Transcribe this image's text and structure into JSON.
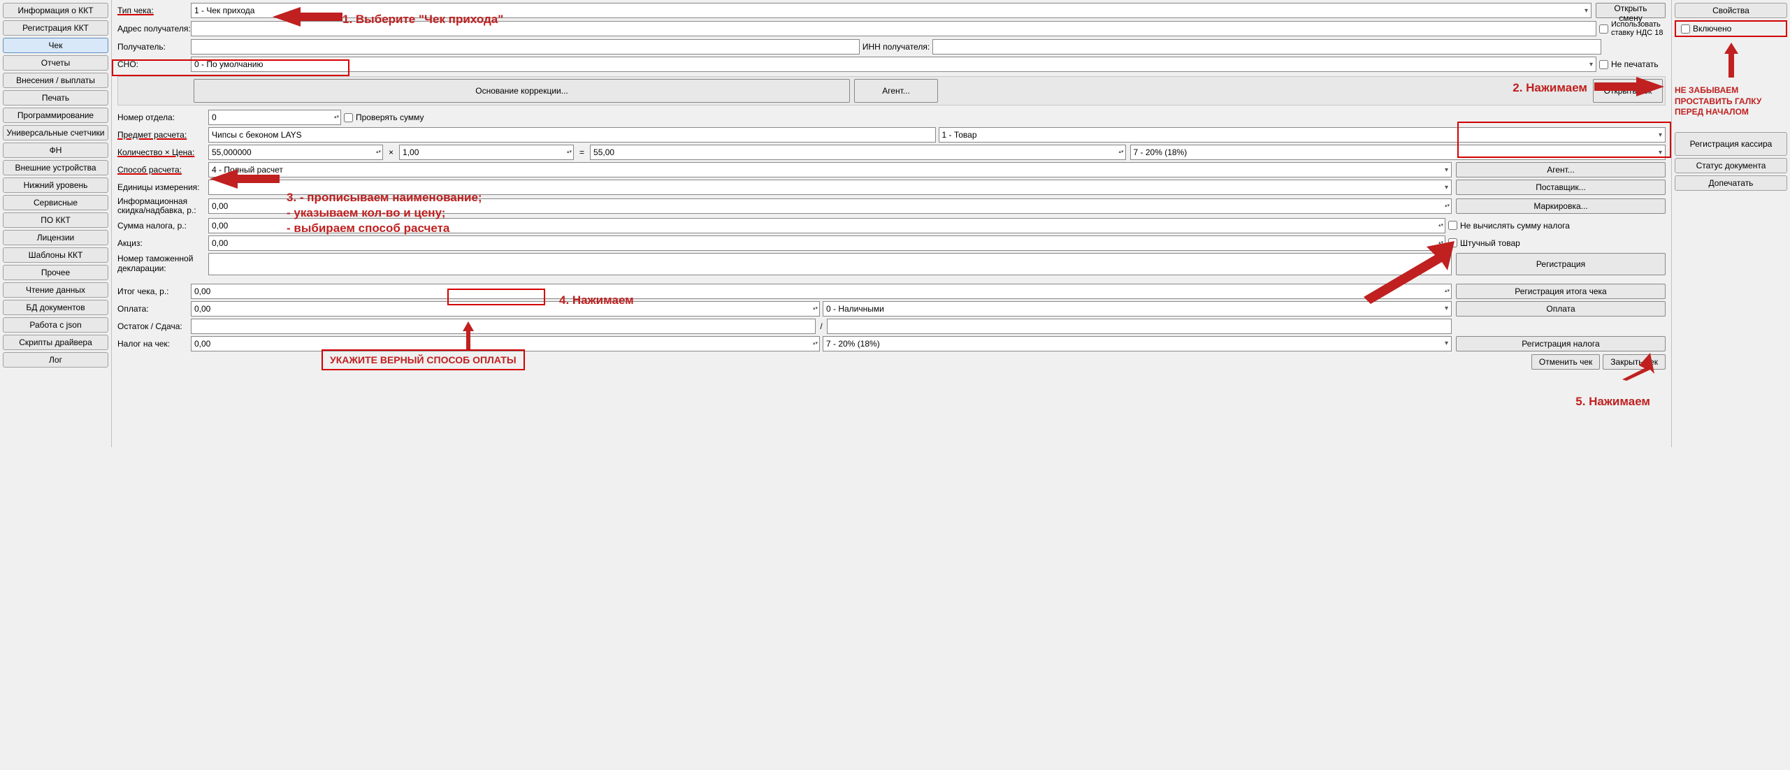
{
  "sidebar": {
    "items": [
      "Информация о ККТ",
      "Регистрация ККТ",
      "Чек",
      "Отчеты",
      "Внесения / выплаты",
      "Печать",
      "Программирование",
      "Универсальные счетчики",
      "ФН",
      "Внешние устройства",
      "Нижний уровень",
      "Сервисные",
      "ПО ККТ",
      "Лицензии",
      "Шаблоны ККТ",
      "Прочее",
      "Чтение данных",
      "БД документов",
      "Работа с json",
      "Скрипты драйвера",
      "Лог"
    ],
    "selected": 2
  },
  "form": {
    "checkType": {
      "label": "Тип чека:",
      "value": "1 - Чек прихода"
    },
    "addr": {
      "label": "Адрес получателя:",
      "value": ""
    },
    "recipient": {
      "label": "Получатель:",
      "value": ""
    },
    "innRecipient": {
      "label": "ИНН получателя:",
      "value": ""
    },
    "sno": {
      "label": "СНО:",
      "value": "0 - По умолчанию"
    },
    "vat18": {
      "label": "Использовать ставку НДС 18"
    },
    "noPrint": {
      "label": "Не печатать"
    },
    "openShift": "Открыть смену",
    "openCheck": "Открыть чек",
    "correction": "Основание коррекции...",
    "agentBtn": "Агент...",
    "deptNo": {
      "label": "Номер отдела:",
      "value": "0"
    },
    "checkSum": "Проверять сумму",
    "item": {
      "label": "Предмет расчета:",
      "value": "Чипсы с беконом LAYS",
      "type": "1 - Товар"
    },
    "qtyPrice": {
      "label": "Количество × Цена:",
      "qty": "55,000000",
      "x": "×",
      "price": "1,00",
      "eq": "=",
      "total": "55,00",
      "vat": "7 - 20% (18%)"
    },
    "payMethod": {
      "label": "Способ расчета:",
      "value": "4 - Полный расчет"
    },
    "unit": {
      "label": "Единицы измерения:",
      "value": ""
    },
    "disc": {
      "label": "Информационная скидка/надбавка, р.:",
      "value": "0,00"
    },
    "taxSum": {
      "label": "Сумма налога, р.:",
      "value": "0,00",
      "noCalc": "Не вычислять сумму налога"
    },
    "excise": {
      "label": "Акциз:",
      "value": "0,00",
      "piece": "Штучный товар"
    },
    "customs": {
      "label": "Номер таможенной декларации:",
      "value": ""
    },
    "btns": {
      "agent": "Агент...",
      "supplier": "Поставщик...",
      "mark": "Маркировка...",
      "reg": "Регистрация"
    },
    "total": {
      "label": "Итог чека, р.:",
      "value": "0,00",
      "btn": "Регистрация итога чека"
    },
    "pay": {
      "label": "Оплата:",
      "value": "0,00",
      "type": "0 - Наличными",
      "btn": "Оплата"
    },
    "rest": {
      "label": "Остаток / Сдача:",
      "v1": "",
      "v2": ""
    },
    "taxCheck": {
      "label": "Налог на чек:",
      "value": "0,00",
      "type": "7 - 20% (18%)",
      "btn": "Регистрация налога"
    },
    "cancel": "Отменить чек",
    "close": "Закрыть чек"
  },
  "rpanel": {
    "props": "Свойства",
    "enabled": "Включено",
    "regCashier": "Регистрация кассира",
    "docStatus": "Статус документа",
    "reprint": "Допечатать",
    "note": "НЕ ЗАБЫВАЕМ ПРОСТАВИТЬ ГАЛКУ ПЕРЕД НАЧАЛОМ"
  },
  "anno": {
    "s1": "1. Выберите \"Чек прихода\"",
    "s2": "2. Нажимаем",
    "s3": "3. - прописываем наименование;\n     - указываем кол-во и цену;\n     - выбираем способ расчета",
    "s4": "4. Нажимаем",
    "s5": "5. Нажимаем",
    "payNote": "УКАЖИТЕ ВЕРНЫЙ СПОСОБ ОПЛАТЫ"
  }
}
